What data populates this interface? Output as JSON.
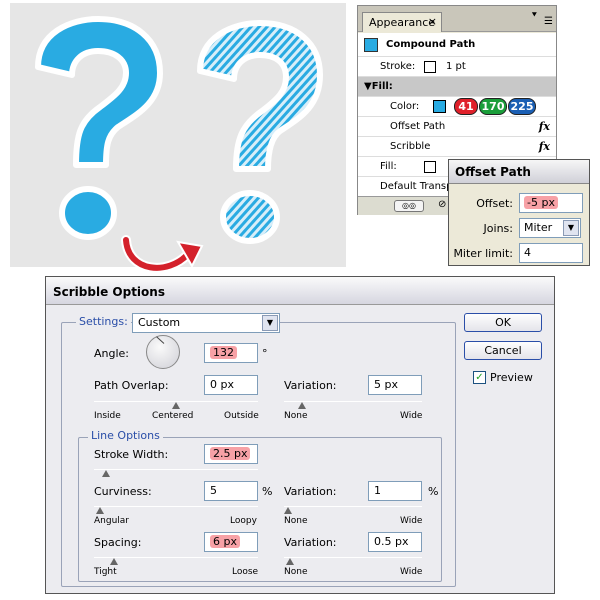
{
  "appearance": {
    "tab_label": "Appearance",
    "close": "×",
    "title": "Compound Path",
    "stroke_label": "Stroke:",
    "stroke_value": "1 pt",
    "fill_header": "▼Fill:",
    "color_label": "Color:",
    "color_r": "41",
    "color_g": "170",
    "color_b": "225",
    "offset_path": "Offset Path",
    "scribble": "Scribble",
    "fill_label": "Fill:",
    "default_transp": "Default Transp",
    "fx": "fx"
  },
  "offset_dialog": {
    "title": "Offset Path",
    "offset_label": "Offset:",
    "offset_value": "-5 px",
    "joins_label": "Joins:",
    "joins_value": "Miter",
    "miter_label": "Miter limit:",
    "miter_value": "4"
  },
  "scribble": {
    "title": "Scribble Options",
    "settings_label": "Settings:",
    "settings_value": "Custom",
    "angle_label": "Angle:",
    "angle_value": "132",
    "degree": "°",
    "path_overlap_label": "Path Overlap:",
    "path_overlap_value": "0 px",
    "variation_label": "Variation:",
    "overlap_variation_value": "5 px",
    "overlap_ticks": [
      "Inside",
      "Centered",
      "Outside"
    ],
    "variation_ticks": [
      "None",
      "Wide"
    ],
    "line_options": "Line Options",
    "stroke_width_label": "Stroke Width:",
    "stroke_width_value": "2.5 px",
    "curviness_label": "Curviness:",
    "curviness_value": "5",
    "curviness_variation_value": "1",
    "percent": "%",
    "curviness_ticks": [
      "Angular",
      "Loopy"
    ],
    "spacing_label": "Spacing:",
    "spacing_value": "6 px",
    "spacing_variation_value": "0.5 px",
    "spacing_ticks": [
      "Tight",
      "Loose"
    ],
    "ok": "OK",
    "cancel": "Cancel",
    "preview": "Preview",
    "preview_checked": true
  },
  "colors": {
    "accent_blue": "#29abe2",
    "highlight": "#f7a1a6",
    "pill_red": "#e0202a",
    "pill_green": "#1a9e3a",
    "pill_blue": "#1a5fb4"
  }
}
